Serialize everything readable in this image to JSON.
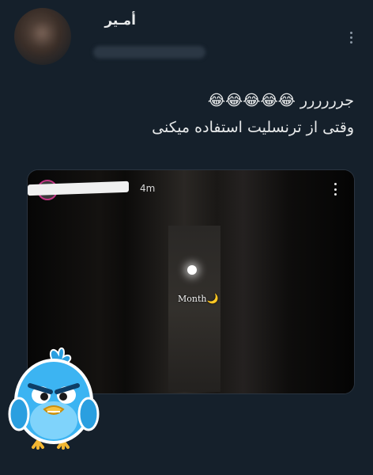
{
  "tweet": {
    "display_name": "أمـير",
    "text_line1": "جرررررر",
    "emojis": "😂😂😂😂😂",
    "text_line2": "وقتی از ترنسلیت استفاده میکنی"
  },
  "media": {
    "story_time": "4m",
    "caption": "Month",
    "caption_icon": "🌙"
  },
  "icons": {
    "more": "more-vertical-icon",
    "sticker": "angry-bird-sticker"
  },
  "colors": {
    "background": "#15202b",
    "text": "#e7e9ea",
    "secondary": "#8b98a5"
  }
}
